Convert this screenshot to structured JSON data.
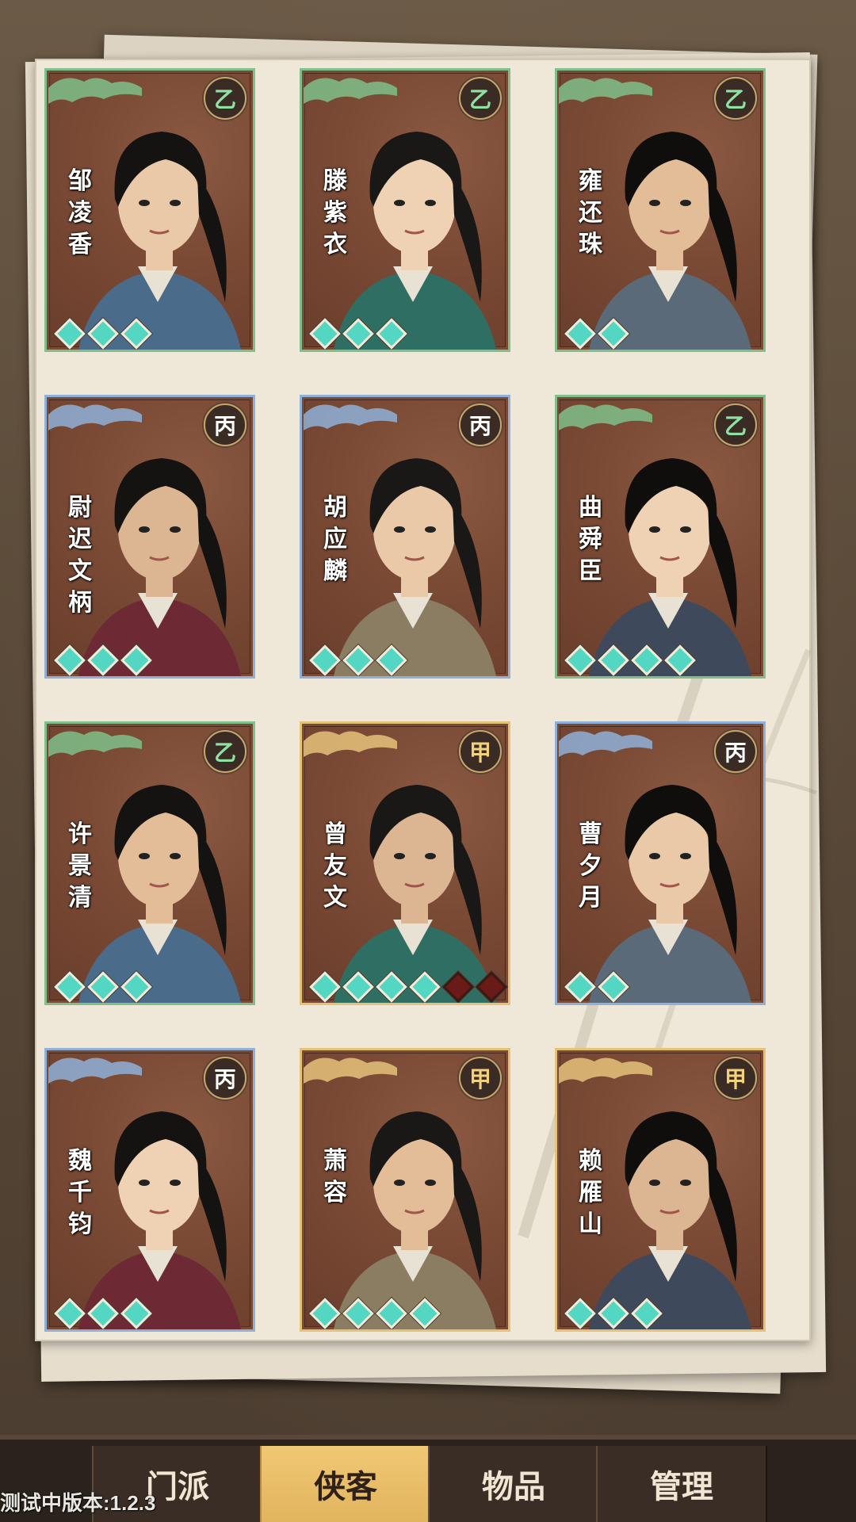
{
  "colors": {
    "tier_yi": "#7fc08a",
    "tier_bing": "#8fb0d8",
    "tier_jia": "#e5c27a",
    "gem_filled": "#53d7c3",
    "gem_empty": "#6b1b17",
    "active_tab": "#e2b45e"
  },
  "cards": [
    {
      "name": [
        "邹",
        "凌",
        "香"
      ],
      "grade": "乙",
      "tier": "yi",
      "stars": 3,
      "empty": 0
    },
    {
      "name": [
        "滕",
        "紫",
        "衣"
      ],
      "grade": "乙",
      "tier": "yi",
      "stars": 3,
      "empty": 0
    },
    {
      "name": [
        "雍",
        "还",
        "珠"
      ],
      "grade": "乙",
      "tier": "yi",
      "stars": 2,
      "empty": 0
    },
    {
      "name": [
        "尉",
        "迟",
        "文",
        "柄"
      ],
      "grade": "丙",
      "tier": "bing",
      "stars": 3,
      "empty": 0
    },
    {
      "name": [
        "胡",
        "应",
        "麟"
      ],
      "grade": "丙",
      "tier": "bing",
      "stars": 3,
      "empty": 0
    },
    {
      "name": [
        "曲",
        "舜",
        "臣"
      ],
      "grade": "乙",
      "tier": "yi",
      "stars": 4,
      "empty": 0
    },
    {
      "name": [
        "许",
        "景",
        "清"
      ],
      "grade": "乙",
      "tier": "yi",
      "stars": 3,
      "empty": 0
    },
    {
      "name": [
        "曾",
        "友",
        "文"
      ],
      "grade": "甲",
      "tier": "jia",
      "stars": 4,
      "empty": 2
    },
    {
      "name": [
        "曹",
        "夕",
        "月"
      ],
      "grade": "丙",
      "tier": "bing",
      "stars": 2,
      "empty": 0
    },
    {
      "name": [
        "魏",
        "千",
        "钧"
      ],
      "grade": "丙",
      "tier": "bing",
      "stars": 3,
      "empty": 0
    },
    {
      "name": [
        "萧",
        "容"
      ],
      "grade": "甲",
      "tier": "jia",
      "stars": 4,
      "empty": 0
    },
    {
      "name": [
        "赖",
        "雁",
        "山"
      ],
      "grade": "甲",
      "tier": "jia",
      "stars": 3,
      "empty": 0
    }
  ],
  "tabs": [
    {
      "label": "门派",
      "active": false
    },
    {
      "label": "侠客",
      "active": true
    },
    {
      "label": "物品",
      "active": false
    },
    {
      "label": "管理",
      "active": false
    }
  ],
  "version_text": "测试中版本:1.2.3"
}
